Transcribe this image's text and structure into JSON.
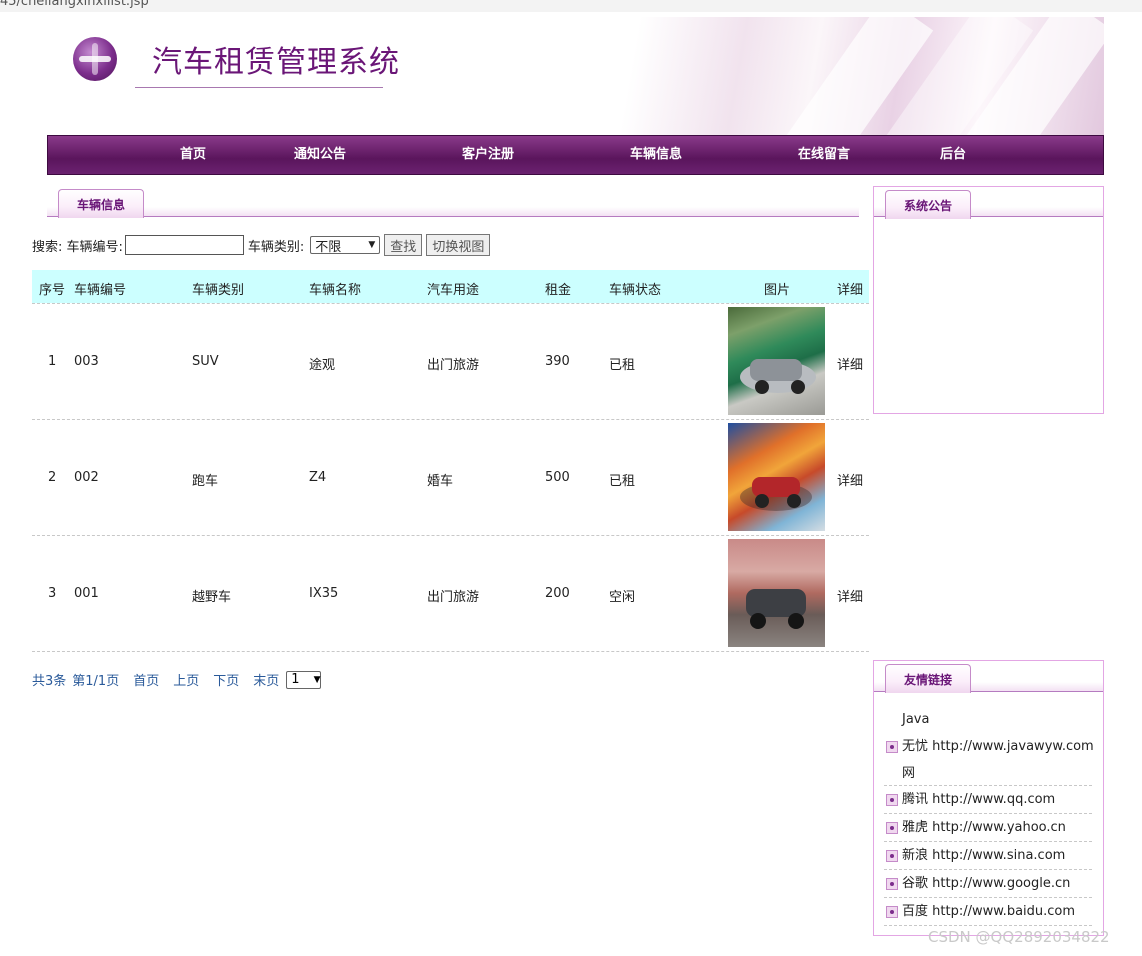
{
  "browser": {
    "url_fragment": "45/cheliangxinxilist.jsp"
  },
  "header": {
    "title": "汽车租赁管理系统"
  },
  "nav": [
    "首页",
    "通知公告",
    "客户注册",
    "车辆信息",
    "在线留言",
    "后台"
  ],
  "main": {
    "tab": "车辆信息",
    "search": {
      "label": "搜索: 车辆编号:",
      "type_label": "车辆类别:",
      "type_value": "不限",
      "search_button": "查找",
      "switch_button": "切换视图"
    },
    "columns": [
      "序号",
      "车辆编号",
      "车辆类别",
      "车辆名称",
      "汽车用途",
      "租金",
      "车辆状态",
      "图片",
      "详细"
    ],
    "rows": [
      {
        "index": "1",
        "code": "003",
        "type": "SUV",
        "name": "途观",
        "use": "出门旅游",
        "rent": "390",
        "status": "已租",
        "detail": "详细",
        "image": "silver-suv-photo"
      },
      {
        "index": "2",
        "code": "002",
        "type": "跑车",
        "name": "Z4",
        "use": "婚车",
        "rent": "500",
        "status": "已租",
        "detail": "详细",
        "image": "red-suv-photo"
      },
      {
        "index": "3",
        "code": "001",
        "type": "越野车",
        "name": "IX35",
        "use": "出门旅游",
        "rent": "200",
        "status": "空闲",
        "detail": "详细",
        "image": "gray-suv-photo"
      }
    ],
    "pager": {
      "total": "共3条",
      "page": "第1/1页",
      "first": "首页",
      "prev": "上页",
      "next": "下页",
      "last": "末页",
      "select": "1"
    }
  },
  "sidebar": {
    "notice_tab": "系统公告",
    "links_tab": "友情链接",
    "links": [
      {
        "name_line1": "Java",
        "name_line2": "无忧",
        "url": "http://www.javawyw.com",
        "name_line3": "网"
      },
      {
        "name": "腾讯",
        "url": "http://www.qq.com"
      },
      {
        "name": "雅虎",
        "url": "http://www.yahoo.cn"
      },
      {
        "name": "新浪",
        "url": "http://www.sina.com"
      },
      {
        "name": "谷歌",
        "url": "http://www.google.cn"
      },
      {
        "name": "百度",
        "url": "http://www.baidu.com"
      }
    ]
  },
  "watermark": "CSDN @QQ2892034822",
  "colors": {
    "accent": "#6a1677",
    "nav": "#5a155c",
    "table_header": "#ccffff",
    "border": "#e3a6e4"
  }
}
